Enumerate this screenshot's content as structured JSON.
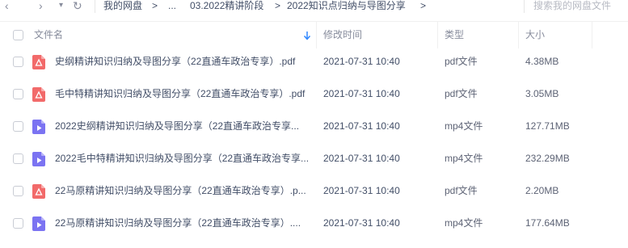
{
  "toolbar": {
    "back": "‹",
    "forward": "›",
    "dropdown": "▾",
    "refresh": "↻",
    "breadcrumbs": [
      "我的网盘",
      "...",
      "03.2022精讲阶段",
      "2022知识点归纳与导图分享"
    ],
    "separator": ">",
    "search_placeholder": "搜索我的网盘文件"
  },
  "table": {
    "headers": {
      "name": "文件名",
      "modified": "修改时间",
      "type": "类型",
      "size": "大小"
    },
    "rows": [
      {
        "icon": "pdf-icon",
        "name": "史纲精讲知识归纳及导图分享（22直通车政治专享）.pdf",
        "modified": "2021-07-31 10:40",
        "type": "pdf文件",
        "size": "4.38MB"
      },
      {
        "icon": "pdf-icon",
        "name": "毛中特精讲知识归纳及导图分享（22直通车政治专享）.pdf",
        "modified": "2021-07-31 10:40",
        "type": "pdf文件",
        "size": "3.05MB"
      },
      {
        "icon": "video-icon",
        "name": "2022史纲精讲知识归纳及导图分享（22直通车政治专享...",
        "modified": "2021-07-31 10:40",
        "type": "mp4文件",
        "size": "127.71MB"
      },
      {
        "icon": "video-icon",
        "name": "2022毛中特精讲知识归纳及导图分享（22直通车政治专享...",
        "modified": "2021-07-31 10:40",
        "type": "mp4文件",
        "size": "232.29MB"
      },
      {
        "icon": "pdf-icon",
        "name": "22马原精讲知识归纳及导图分享（22直通车政治专享）.p...",
        "modified": "2021-07-31 10:40",
        "type": "pdf文件",
        "size": "2.20MB"
      },
      {
        "icon": "video-icon",
        "name": "22马原精讲知识归纳及导图分享（22直通车政治专享）....",
        "modified": "2021-07-31 10:40",
        "type": "mp4文件",
        "size": "177.64MB"
      }
    ]
  },
  "colors": {
    "pdf": "#f26a6a",
    "video": "#7b73f2",
    "accent": "#2f87ff"
  }
}
